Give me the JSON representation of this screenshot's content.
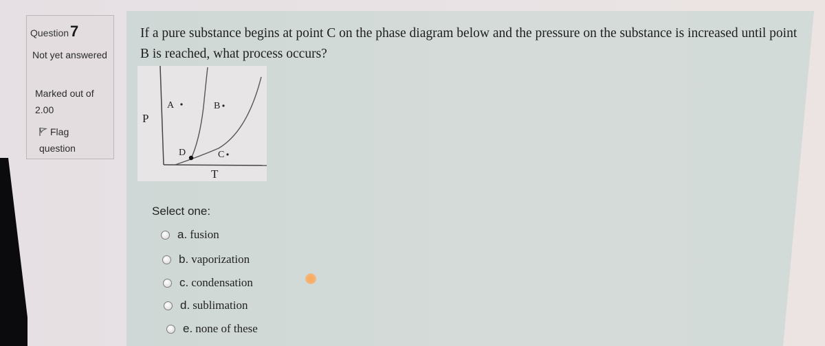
{
  "sidebar": {
    "question_label": "Question",
    "question_number": "7",
    "state": "Not yet answered",
    "marked_label": "Marked out of 2.00",
    "flag_label": "Flag question"
  },
  "question": {
    "text": "If a pure substance begins at point C on the phase diagram below and the pressure on the substance is increased until point B is reached, what process occurs?"
  },
  "diagram": {
    "y_axis_label": "P",
    "x_axis_label": "T",
    "points": [
      {
        "label": "A"
      },
      {
        "label": "B"
      },
      {
        "label": "C"
      },
      {
        "label": "D"
      }
    ]
  },
  "answers": {
    "prompt": "Select one:",
    "options": [
      {
        "letter": "a.",
        "text": "fusion",
        "selected": false
      },
      {
        "letter": "b.",
        "text": "vaporization",
        "selected": false
      },
      {
        "letter": "c.",
        "text": "condensation",
        "selected": false
      },
      {
        "letter": "d.",
        "text": "sublimation",
        "selected": false
      },
      {
        "letter": "e.",
        "text": "none of these",
        "selected": false
      }
    ]
  }
}
